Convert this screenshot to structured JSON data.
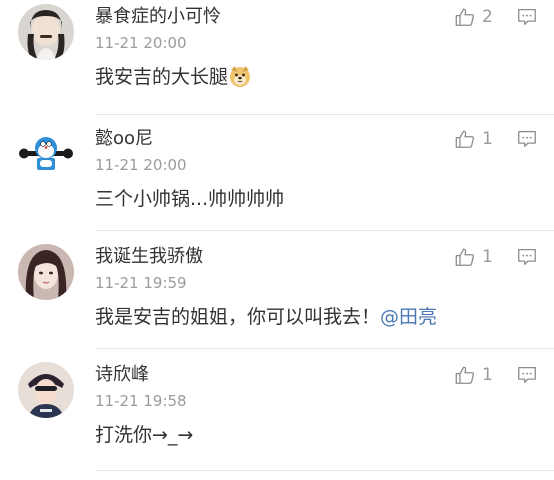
{
  "comments": [
    {
      "username": "暴食症的小可怜",
      "time": "11-21 20:00",
      "text": "我安吉的大长腿",
      "emoji": "dog-face-emoji",
      "likes": "2"
    },
    {
      "username": "懿oo尼",
      "time": "11-21 20:00",
      "text": "三个小帅锅...帅帅帅帅",
      "likes": "1"
    },
    {
      "username": "我诞生我骄傲",
      "time": "11-21 19:59",
      "text": "我是安吉的姐姐，你可以叫我去！",
      "mention": "@田亮",
      "likes": "1"
    },
    {
      "username": "诗欣峰",
      "time": "11-21 19:58",
      "text": "打洗你→_→",
      "likes": "1"
    }
  ],
  "colors": {
    "mention": "#4a78b5",
    "secondary_text": "#9b9b9b",
    "primary_text": "#333333",
    "divider": "#e6e6e6"
  }
}
